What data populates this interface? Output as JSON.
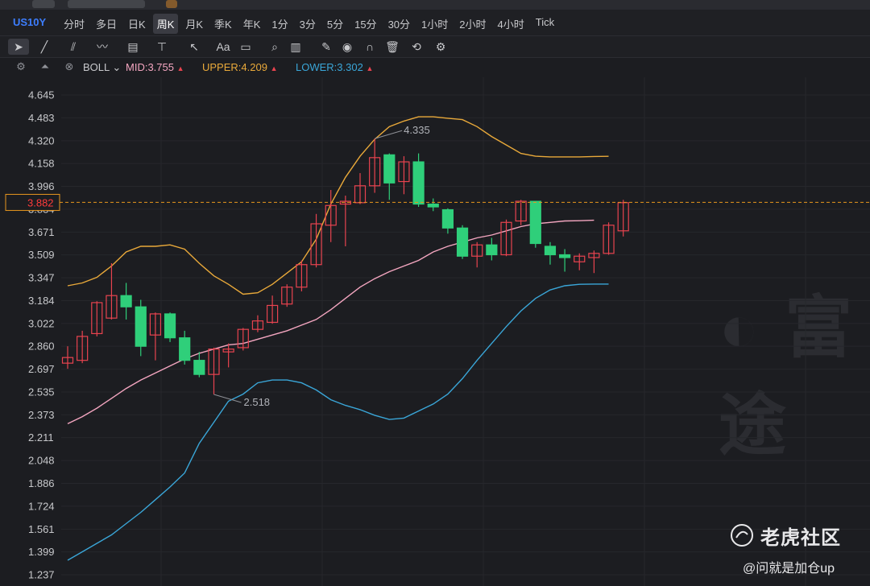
{
  "header": {
    "symbol": "US10Y",
    "periods": [
      "分时",
      "多日",
      "日K",
      "周K",
      "月K",
      "季K",
      "年K",
      "1分",
      "3分",
      "5分",
      "15分",
      "30分",
      "1小时",
      "2小时",
      "4小时",
      "Tick"
    ],
    "active_period": "周K",
    "tools": [
      "pointer-icon",
      "line-icon",
      "channel-icon",
      "wave-icon",
      "fib-icon",
      "measure-icon",
      "arrow-icon",
      "text-icon",
      "comment-icon",
      "zoom-icon",
      "stats-icon",
      "pen-icon",
      "eye-icon",
      "magnet-icon",
      "trash-icon",
      "sync-icon",
      "gear-icon"
    ],
    "text_tool_label": "Aa"
  },
  "indicator": {
    "name": "BOLL",
    "mid": "MID:3.755",
    "upper": "UPPER:4.209",
    "lower": "LOWER:3.302",
    "colors": {
      "mid": "#f4a6c0",
      "upper": "#e9a93a",
      "lower": "#3aa6d8",
      "up": "#e8434f",
      "down": "#2fcf7a",
      "grid": "#26272c"
    }
  },
  "price_axis": {
    "ticks": [
      "4.645",
      "4.483",
      "4.320",
      "4.158",
      "3.996",
      "3.834",
      "3.671",
      "3.509",
      "3.347",
      "3.184",
      "3.022",
      "2.860",
      "2.697",
      "2.535",
      "2.373",
      "2.211",
      "2.048",
      "1.886",
      "1.724",
      "1.561",
      "1.399",
      "1.237"
    ],
    "current_price": "3.882",
    "high_label": "4.335",
    "low_label": "2.518"
  },
  "chart_data": {
    "type": "candlestick",
    "ylim": [
      1.237,
      4.645
    ],
    "candles": [
      {
        "o": 2.74,
        "c": 2.78,
        "h": 2.86,
        "l": 2.7
      },
      {
        "o": 2.76,
        "c": 2.93,
        "h": 2.97,
        "l": 2.74
      },
      {
        "o": 2.95,
        "c": 3.17,
        "h": 3.18,
        "l": 2.93
      },
      {
        "o": 3.06,
        "c": 3.22,
        "h": 3.45,
        "l": 3.05
      },
      {
        "o": 3.22,
        "c": 3.14,
        "h": 3.31,
        "l": 3.05
      },
      {
        "o": 3.14,
        "c": 2.86,
        "h": 3.19,
        "l": 2.79
      },
      {
        "o": 2.94,
        "c": 3.09,
        "h": 3.1,
        "l": 2.76
      },
      {
        "o": 3.09,
        "c": 2.92,
        "h": 3.1,
        "l": 2.89
      },
      {
        "o": 2.92,
        "c": 2.76,
        "h": 2.97,
        "l": 2.73
      },
      {
        "o": 2.76,
        "c": 2.66,
        "h": 2.82,
        "l": 2.64
      },
      {
        "o": 2.66,
        "c": 2.84,
        "h": 2.85,
        "l": 2.518
      },
      {
        "o": 2.82,
        "c": 2.84,
        "h": 2.88,
        "l": 2.71
      },
      {
        "o": 2.85,
        "c": 2.98,
        "h": 2.99,
        "l": 2.83
      },
      {
        "o": 2.98,
        "c": 3.04,
        "h": 3.08,
        "l": 2.96
      },
      {
        "o": 3.03,
        "c": 3.15,
        "h": 3.22,
        "l": 3.02
      },
      {
        "o": 3.16,
        "c": 3.28,
        "h": 3.3,
        "l": 3.14
      },
      {
        "o": 3.28,
        "c": 3.44,
        "h": 3.47,
        "l": 3.25
      },
      {
        "o": 3.44,
        "c": 3.73,
        "h": 3.8,
        "l": 3.42
      },
      {
        "o": 3.72,
        "c": 3.86,
        "h": 3.97,
        "l": 3.6
      },
      {
        "o": 3.87,
        "c": 3.89,
        "h": 3.93,
        "l": 3.57
      },
      {
        "o": 3.88,
        "c": 4.0,
        "h": 4.09,
        "l": 3.87
      },
      {
        "o": 4.0,
        "c": 4.2,
        "h": 4.335,
        "l": 3.95
      },
      {
        "o": 4.22,
        "c": 4.02,
        "h": 4.23,
        "l": 3.9
      },
      {
        "o": 4.03,
        "c": 4.17,
        "h": 4.21,
        "l": 3.94
      },
      {
        "o": 4.17,
        "c": 3.87,
        "h": 4.23,
        "l": 3.85
      },
      {
        "o": 3.87,
        "c": 3.85,
        "h": 3.91,
        "l": 3.82
      },
      {
        "o": 3.83,
        "c": 3.7,
        "h": 3.84,
        "l": 3.66
      },
      {
        "o": 3.7,
        "c": 3.5,
        "h": 3.72,
        "l": 3.48
      },
      {
        "o": 3.5,
        "c": 3.58,
        "h": 3.6,
        "l": 3.42
      },
      {
        "o": 3.58,
        "c": 3.51,
        "h": 3.63,
        "l": 3.47
      },
      {
        "o": 3.51,
        "c": 3.74,
        "h": 3.76,
        "l": 3.5
      },
      {
        "o": 3.75,
        "c": 3.89,
        "h": 3.9,
        "l": 3.72
      },
      {
        "o": 3.89,
        "c": 3.59,
        "h": 3.89,
        "l": 3.56
      },
      {
        "o": 3.57,
        "c": 3.51,
        "h": 3.6,
        "l": 3.44
      },
      {
        "o": 3.51,
        "c": 3.49,
        "h": 3.55,
        "l": 3.39
      },
      {
        "o": 3.46,
        "c": 3.5,
        "h": 3.52,
        "l": 3.4
      },
      {
        "o": 3.49,
        "c": 3.52,
        "h": 3.54,
        "l": 3.38
      },
      {
        "o": 3.52,
        "c": 3.72,
        "h": 3.74,
        "l": 3.51
      },
      {
        "o": 3.68,
        "c": 3.88,
        "h": 3.9,
        "l": 3.64
      }
    ],
    "upper": [
      3.29,
      3.31,
      3.35,
      3.43,
      3.53,
      3.57,
      3.57,
      3.58,
      3.55,
      3.45,
      3.36,
      3.3,
      3.23,
      3.24,
      3.3,
      3.38,
      3.46,
      3.62,
      3.87,
      4.06,
      4.21,
      4.33,
      4.42,
      4.46,
      4.49,
      4.49,
      4.48,
      4.47,
      4.42,
      4.35,
      4.29,
      4.23,
      4.21,
      4.205,
      4.205,
      4.205,
      4.208,
      4.209
    ],
    "mid": [
      2.31,
      2.36,
      2.42,
      2.49,
      2.56,
      2.62,
      2.67,
      2.72,
      2.77,
      2.81,
      2.84,
      2.87,
      2.88,
      2.91,
      2.94,
      2.97,
      3.01,
      3.05,
      3.12,
      3.2,
      3.28,
      3.34,
      3.39,
      3.43,
      3.47,
      3.53,
      3.57,
      3.6,
      3.63,
      3.65,
      3.68,
      3.71,
      3.73,
      3.74,
      3.75,
      3.752,
      3.755
    ],
    "lower": [
      1.34,
      1.4,
      1.46,
      1.52,
      1.6,
      1.68,
      1.77,
      1.86,
      1.96,
      2.17,
      2.32,
      2.47,
      2.52,
      2.6,
      2.62,
      2.62,
      2.6,
      2.55,
      2.48,
      2.44,
      2.41,
      2.37,
      2.34,
      2.35,
      2.4,
      2.45,
      2.52,
      2.63,
      2.76,
      2.88,
      3.0,
      3.11,
      3.2,
      3.26,
      3.29,
      3.3,
      3.302,
      3.302
    ]
  },
  "watermark": {
    "brand": "老虎社区",
    "user": "@问就是加仓up"
  }
}
